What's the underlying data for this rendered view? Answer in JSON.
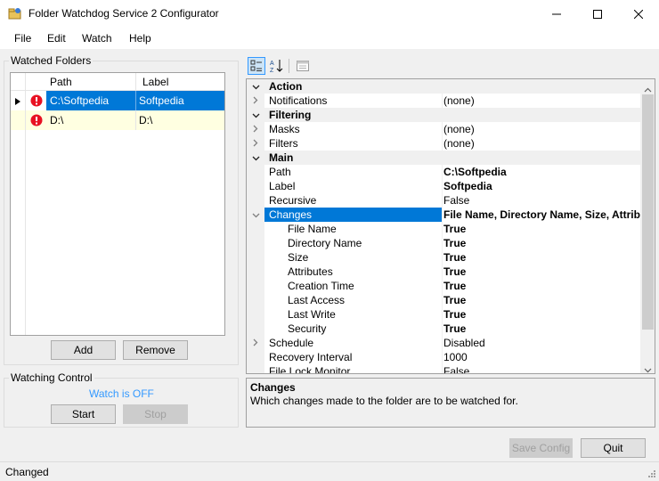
{
  "window": {
    "title": "Folder Watchdog Service 2 Configurator",
    "minimize_label": "Minimize",
    "maximize_label": "Maximize",
    "close_label": "Close"
  },
  "menu": [
    "File",
    "Edit",
    "Watch",
    "Help"
  ],
  "watched_folders": {
    "title": "Watched Folders",
    "columns": [
      "Path",
      "Label"
    ],
    "rows": [
      {
        "path": "C:\\Softpedia",
        "label": "Softpedia",
        "selected": true
      },
      {
        "path": "D:\\",
        "label": "D:\\",
        "selected": false
      }
    ],
    "add_label": "Add",
    "remove_label": "Remove"
  },
  "watching_control": {
    "title": "Watching Control",
    "status": "Watch is OFF",
    "start_label": "Start",
    "stop_label": "Stop"
  },
  "property_grid": {
    "rows": [
      {
        "type": "category",
        "name": "Action"
      },
      {
        "type": "property",
        "name": "Notifications",
        "value": "(none)",
        "expander": "collapsed"
      },
      {
        "type": "category",
        "name": "Filtering"
      },
      {
        "type": "property",
        "name": "Masks",
        "value": "(none)",
        "expander": "collapsed"
      },
      {
        "type": "property",
        "name": "Filters",
        "value": "(none)",
        "expander": "collapsed"
      },
      {
        "type": "category",
        "name": "Main"
      },
      {
        "type": "property",
        "name": "Path",
        "value": "C:\\Softpedia",
        "bold": true
      },
      {
        "type": "property",
        "name": "Label",
        "value": "Softpedia",
        "bold": true
      },
      {
        "type": "property",
        "name": "Recursive",
        "value": "False"
      },
      {
        "type": "property",
        "name": "Changes",
        "value": "File Name, Directory Name, Size, Attributes",
        "bold": true,
        "expander": "expanded",
        "selected": true
      },
      {
        "type": "sub",
        "name": "File Name",
        "value": "True",
        "bold": true
      },
      {
        "type": "sub",
        "name": "Directory Name",
        "value": "True",
        "bold": true
      },
      {
        "type": "sub",
        "name": "Size",
        "value": "True",
        "bold": true
      },
      {
        "type": "sub",
        "name": "Attributes",
        "value": "True",
        "bold": true
      },
      {
        "type": "sub",
        "name": "Creation Time",
        "value": "True",
        "bold": true
      },
      {
        "type": "sub",
        "name": "Last Access",
        "value": "True",
        "bold": true
      },
      {
        "type": "sub",
        "name": "Last Write",
        "value": "True",
        "bold": true
      },
      {
        "type": "sub",
        "name": "Security",
        "value": "True",
        "bold": true
      },
      {
        "type": "property",
        "name": "Schedule",
        "value": "Disabled",
        "expander": "collapsed"
      },
      {
        "type": "property",
        "name": "Recovery Interval",
        "value": "1000"
      },
      {
        "type": "property",
        "name": "File Lock Monitor",
        "value": "False"
      }
    ]
  },
  "description": {
    "title": "Changes",
    "text": "Which changes made to the folder are to be watched for."
  },
  "save_config_label": "Save Config",
  "quit_label": "Quit",
  "status_text": "Changed",
  "colors": {
    "selection": "#0078d7",
    "alt_row": "#ffffe1",
    "link_status": "#3399ff",
    "error_icon": "#e81123"
  }
}
